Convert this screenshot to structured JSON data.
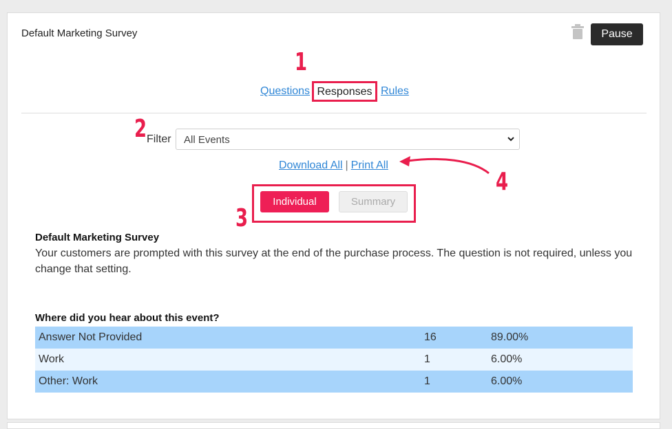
{
  "header": {
    "survey_title": "Default Marketing Survey",
    "pause_label": "Pause",
    "trash_icon": "trash-icon"
  },
  "tabs": {
    "questions": "Questions",
    "responses": "Responses",
    "rules": "Rules"
  },
  "filter": {
    "label": "Filter",
    "selected": "All Events"
  },
  "actions": {
    "download_all": "Download All",
    "separator": "|",
    "print_all": "Print All"
  },
  "view_toggle": {
    "individual": "Individual",
    "summary": "Summary"
  },
  "annotations": {
    "n1": "1",
    "n2": "2",
    "n3": "3",
    "n4": "4",
    "color": "#e91e4d"
  },
  "description": {
    "title": "Default Marketing Survey",
    "body": "Your customers are prompted with this survey at the end of the purchase process. The question is not required, unless you change that setting."
  },
  "question": {
    "text": "Where did you hear about this event?",
    "rows": [
      {
        "answer": "Answer Not Provided",
        "count": "16",
        "percent": "89.00%"
      },
      {
        "answer": "Work",
        "count": "1",
        "percent": "6.00%"
      },
      {
        "answer": "Other: Work",
        "count": "1",
        "percent": "6.00%"
      }
    ]
  },
  "colors": {
    "accent": "#ee1f56",
    "link": "#2f86d6",
    "row_dark": "#a7d4fb",
    "row_light": "#eaf5ff"
  }
}
